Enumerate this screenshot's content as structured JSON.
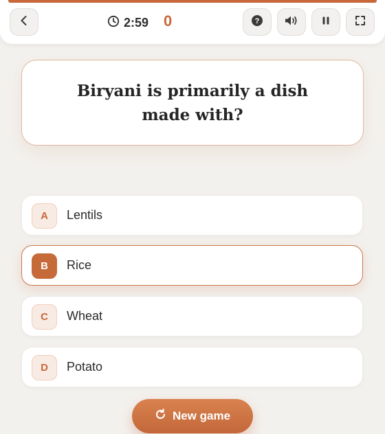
{
  "colors": {
    "accent": "#c8683a",
    "background": "#f3f1ee",
    "card": "#ffffff",
    "text": "#252525"
  },
  "header": {
    "back_icon": "chevron-left-icon",
    "timer_icon": "clock-icon",
    "timer": "2:59",
    "score": "0",
    "help_icon": "question-circle-icon",
    "sound_icon": "speaker-icon",
    "pause_icon": "pause-icon",
    "fullscreen_icon": "fullscreen-icon"
  },
  "question": {
    "text": "Biryani is primarily a dish made with?"
  },
  "answers": [
    {
      "letter": "A",
      "text": "Lentils",
      "selected": false
    },
    {
      "letter": "B",
      "text": "Rice",
      "selected": true
    },
    {
      "letter": "C",
      "text": "Wheat",
      "selected": false
    },
    {
      "letter": "D",
      "text": "Potato",
      "selected": false
    }
  ],
  "new_game": {
    "label": "New game",
    "icon": "refresh-icon"
  }
}
